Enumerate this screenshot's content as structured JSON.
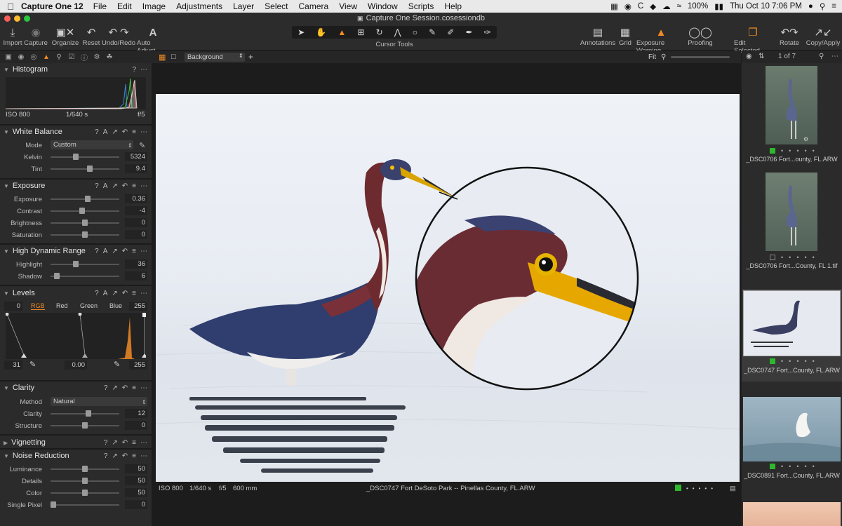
{
  "menubar": {
    "app": "Capture One 12",
    "items": [
      "File",
      "Edit",
      "Image",
      "Adjustments",
      "Layer",
      "Select",
      "Camera",
      "View",
      "Window",
      "Scripts",
      "Help"
    ],
    "battery": "100%",
    "clock": "Thu Oct 10  7:06 PM"
  },
  "window": {
    "title": "Capture One Session.cosessiondb"
  },
  "toolbar": {
    "import": "Import",
    "capture": "Capture",
    "organize": "Organize",
    "reset": "Reset",
    "undo_redo": "Undo/Redo",
    "auto_adjust": "Auto Adjust",
    "cursor_tools": "Cursor Tools",
    "annotations": "Annotations",
    "grid": "Grid",
    "exposure_warning": "Exposure Warning",
    "proofing": "Proofing",
    "edit_selected": "Edit Selected",
    "rotate": "Rotate",
    "copy_apply": "Copy/Apply"
  },
  "viewer": {
    "background_select": "Background",
    "zoom": "Fit",
    "bottom": {
      "iso": "ISO 800",
      "shutter": "1/640 s",
      "aperture": "f/5",
      "focal": "600 mm",
      "filename": "_DSC0747 Fort DeSoto Park -- Pinellas County, FL.ARW"
    }
  },
  "tools": {
    "histogram": {
      "title": "Histogram",
      "iso": "ISO 800",
      "shutter": "1/640 s",
      "aperture": "f/5"
    },
    "white_balance": {
      "title": "White Balance",
      "mode_label": "Mode",
      "mode_value": "Custom",
      "kelvin_label": "Kelvin",
      "kelvin": "5324",
      "kelvin_level": 0.36,
      "tint_label": "Tint",
      "tint": "9.4",
      "tint_level": 0.58
    },
    "exposure": {
      "title": "Exposure",
      "rows": [
        {
          "label": "Exposure",
          "value": "0.36",
          "level": 0.54
        },
        {
          "label": "Contrast",
          "value": "-4",
          "level": 0.45
        },
        {
          "label": "Brightness",
          "value": "0",
          "level": 0.5
        },
        {
          "label": "Saturation",
          "value": "0",
          "level": 0.5
        }
      ]
    },
    "hdr": {
      "title": "High Dynamic Range",
      "rows": [
        {
          "label": "Highlight",
          "value": "36",
          "level": 0.36
        },
        {
          "label": "Shadow",
          "value": "6",
          "level": 0.06
        }
      ]
    },
    "levels": {
      "title": "Levels",
      "left_value": "0",
      "right_value": "255",
      "channels": [
        "RGB",
        "Red",
        "Green",
        "Blue"
      ],
      "input_low": "31",
      "mid": "0.00",
      "input_high": "255"
    },
    "clarity": {
      "title": "Clarity",
      "method_label": "Method",
      "method_value": "Natural",
      "rows": [
        {
          "label": "Clarity",
          "value": "12",
          "level": 0.56
        },
        {
          "label": "Structure",
          "value": "0",
          "level": 0.5
        }
      ]
    },
    "vignetting": {
      "title": "Vignetting"
    },
    "noise_reduction": {
      "title": "Noise Reduction",
      "rows": [
        {
          "label": "Luminance",
          "value": "50",
          "level": 0.5
        },
        {
          "label": "Details",
          "value": "50",
          "level": 0.5
        },
        {
          "label": "Color",
          "value": "50",
          "level": 0.5
        },
        {
          "label": "Single Pixel",
          "value": "0",
          "level": 0.0
        }
      ]
    }
  },
  "browser": {
    "count": "1 of 7",
    "thumbs": [
      {
        "name": "_DSC0706 Fort...ounty, FL.ARW",
        "tagged": true
      },
      {
        "name": "_DSC0706 Fort...County, FL 1.tif",
        "tagged": false
      },
      {
        "name": "_DSC0747 Fort...County, FL.ARW",
        "tagged": true
      },
      {
        "name": "_DSC0891 Fort...County, FL.ARW",
        "tagged": true
      }
    ]
  },
  "colors": {
    "accent": "#f08a24",
    "tag_green": "#2db82d"
  }
}
